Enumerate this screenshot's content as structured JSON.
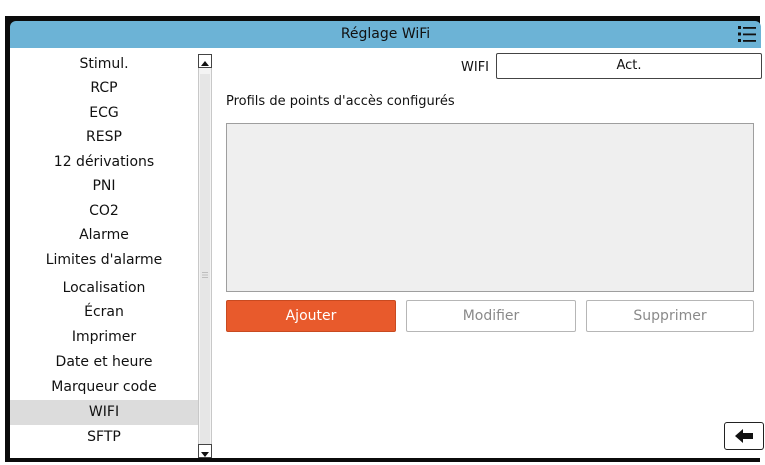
{
  "header": {
    "title": "Réglage WiFi",
    "menu_icon": "list-menu-icon"
  },
  "sidebar": {
    "items": [
      {
        "label": "Stimul."
      },
      {
        "label": "RCP"
      },
      {
        "label": "ECG"
      },
      {
        "label": "RESP"
      },
      {
        "label": "12 dérivations"
      },
      {
        "label": "PNI"
      },
      {
        "label": "CO2"
      },
      {
        "label": "Alarme"
      },
      {
        "label": "Limites d'alarme"
      },
      {
        "label": "Localisation"
      },
      {
        "label": "Écran"
      },
      {
        "label": "Imprimer"
      },
      {
        "label": "Date et heure"
      },
      {
        "label": "Marqueur code"
      },
      {
        "label": "WIFI"
      },
      {
        "label": "SFTP"
      }
    ],
    "selected": "WIFI"
  },
  "wifi": {
    "label": "WIFI",
    "value": "Act."
  },
  "profiles": {
    "title": "Profils de points d'accès configurés",
    "items": []
  },
  "buttons": {
    "add": "Ajouter",
    "edit": "Modifier",
    "delete": "Supprimer"
  },
  "colors": {
    "title_bar": "#6cb3d6",
    "primary_button": "#e85a2c",
    "selected_row": "#dcdcdc"
  }
}
